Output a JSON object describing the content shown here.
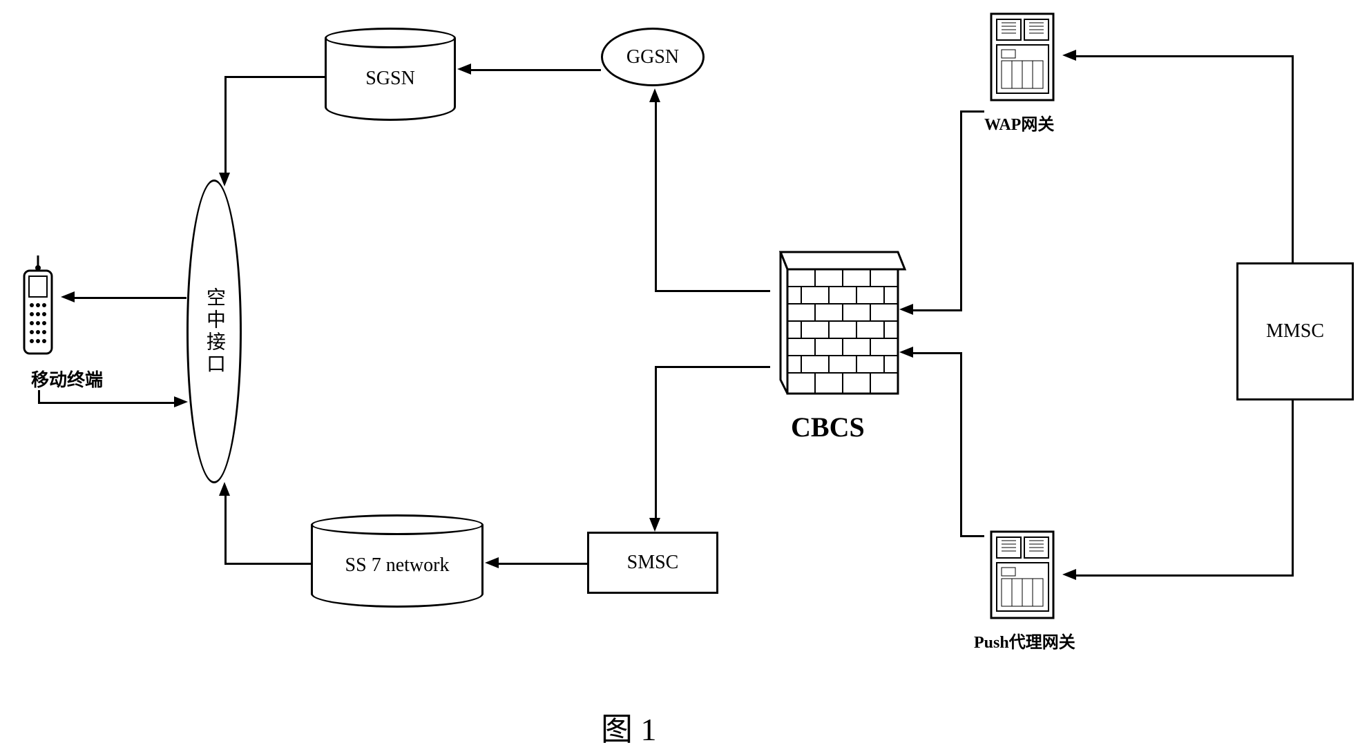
{
  "nodes": {
    "mobile_terminal": "移动终端",
    "air_interface": "空中接口",
    "sgsn": "SGSN",
    "ggsn": "GGSN",
    "ss7": "SS 7 network",
    "smsc": "SMSC",
    "cbcs": "CBCS",
    "wap_gateway": "WAP网关",
    "push_gateway": "Push代理网关",
    "mmsc": "MMSC"
  },
  "figure_label": "图  1",
  "connections": [
    {
      "from": "air_interface",
      "to": "mobile_terminal",
      "direction": "left"
    },
    {
      "from": "mobile_terminal",
      "to": "air_interface",
      "direction": "right"
    },
    {
      "from": "sgsn",
      "to": "air_interface",
      "direction": "diagonal-down-left"
    },
    {
      "from": "ggsn",
      "to": "sgsn",
      "direction": "left"
    },
    {
      "from": "cbcs",
      "to": "ggsn",
      "direction": "up-left"
    },
    {
      "from": "ss7",
      "to": "air_interface",
      "direction": "diagonal-up-left"
    },
    {
      "from": "smsc",
      "to": "ss7",
      "direction": "left"
    },
    {
      "from": "cbcs",
      "to": "smsc",
      "direction": "down-left"
    },
    {
      "from": "wap_gateway",
      "to": "cbcs",
      "direction": "down-left"
    },
    {
      "from": "push_gateway",
      "to": "cbcs",
      "direction": "up-left"
    },
    {
      "from": "mmsc",
      "to": "wap_gateway",
      "direction": "up-left"
    },
    {
      "from": "mmsc",
      "to": "push_gateway",
      "direction": "down-left"
    }
  ]
}
